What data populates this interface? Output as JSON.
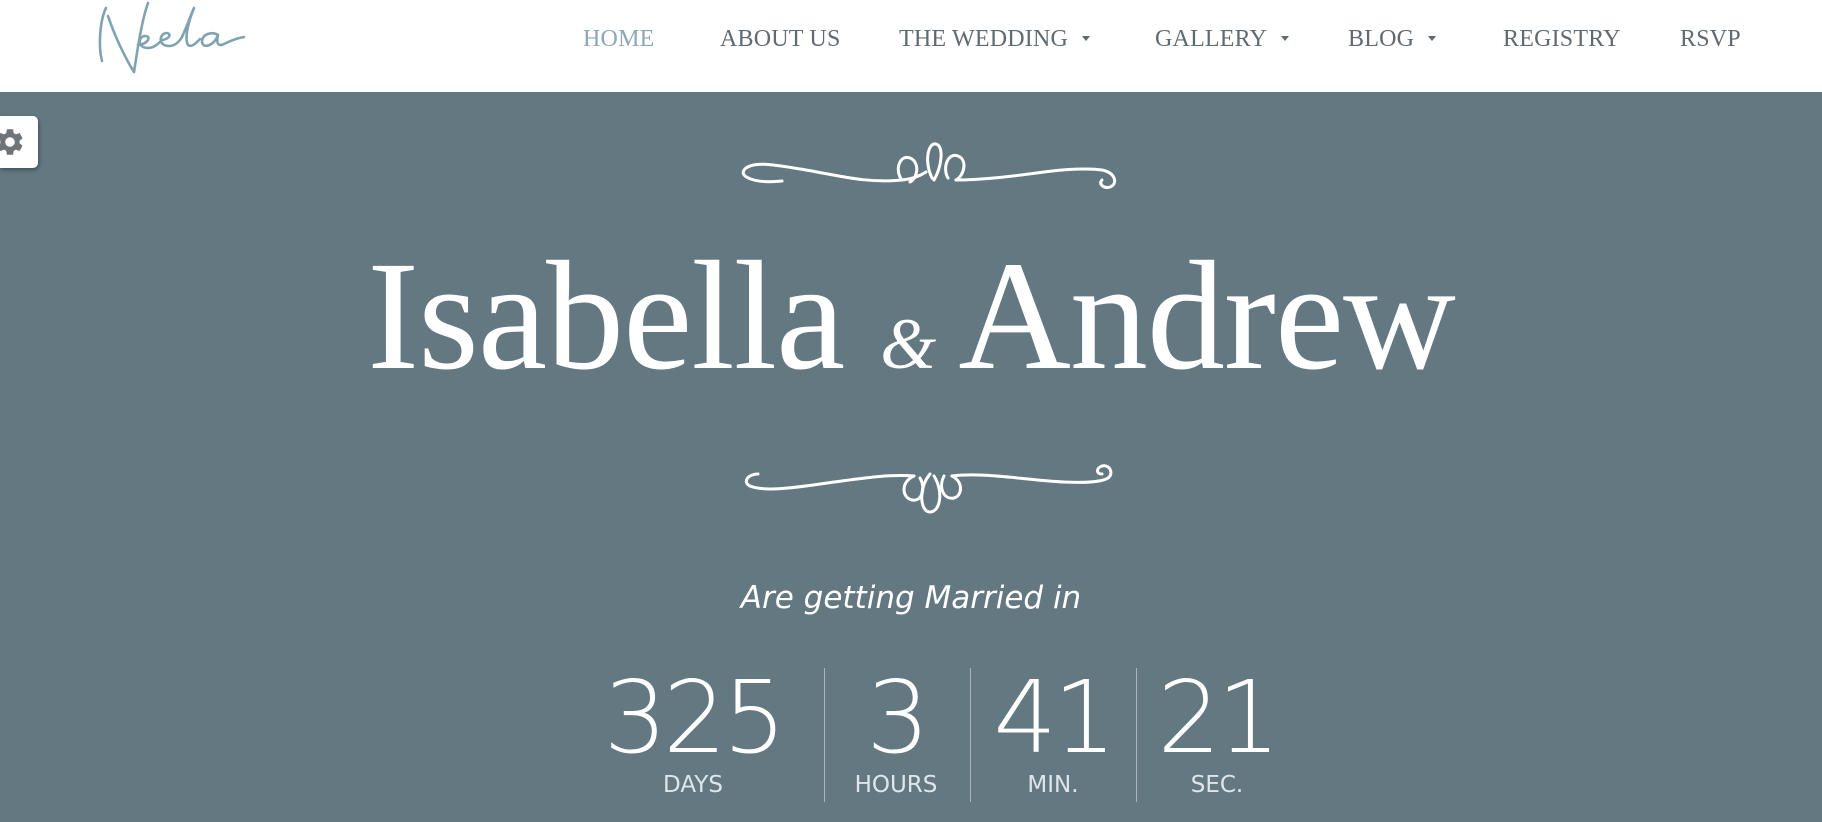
{
  "brand": {
    "logo_text": "Neela",
    "logo_color": "#7fa3b0"
  },
  "nav": {
    "items": [
      {
        "label": "HOME",
        "active": true
      },
      {
        "label": "ABOUT US"
      },
      {
        "label": "THE WEDDING",
        "has_dropdown": true
      },
      {
        "label": "GALLERY",
        "has_dropdown": true
      },
      {
        "label": "BLOG",
        "has_dropdown": true
      },
      {
        "label": "REGISTRY"
      },
      {
        "label": "RSVP"
      }
    ]
  },
  "settings": {
    "icon": "gear-icon"
  },
  "hero": {
    "bride": "Isabella",
    "ampersand": "&",
    "groom": "Andrew",
    "tagline": "Are getting Married in",
    "background": "#647882"
  },
  "countdown": {
    "units": [
      {
        "value": "325",
        "label": "DAYS"
      },
      {
        "value": "3",
        "label": "HOURS"
      },
      {
        "value": "41",
        "label": "MIN."
      },
      {
        "value": "21",
        "label": "SEC."
      }
    ]
  }
}
